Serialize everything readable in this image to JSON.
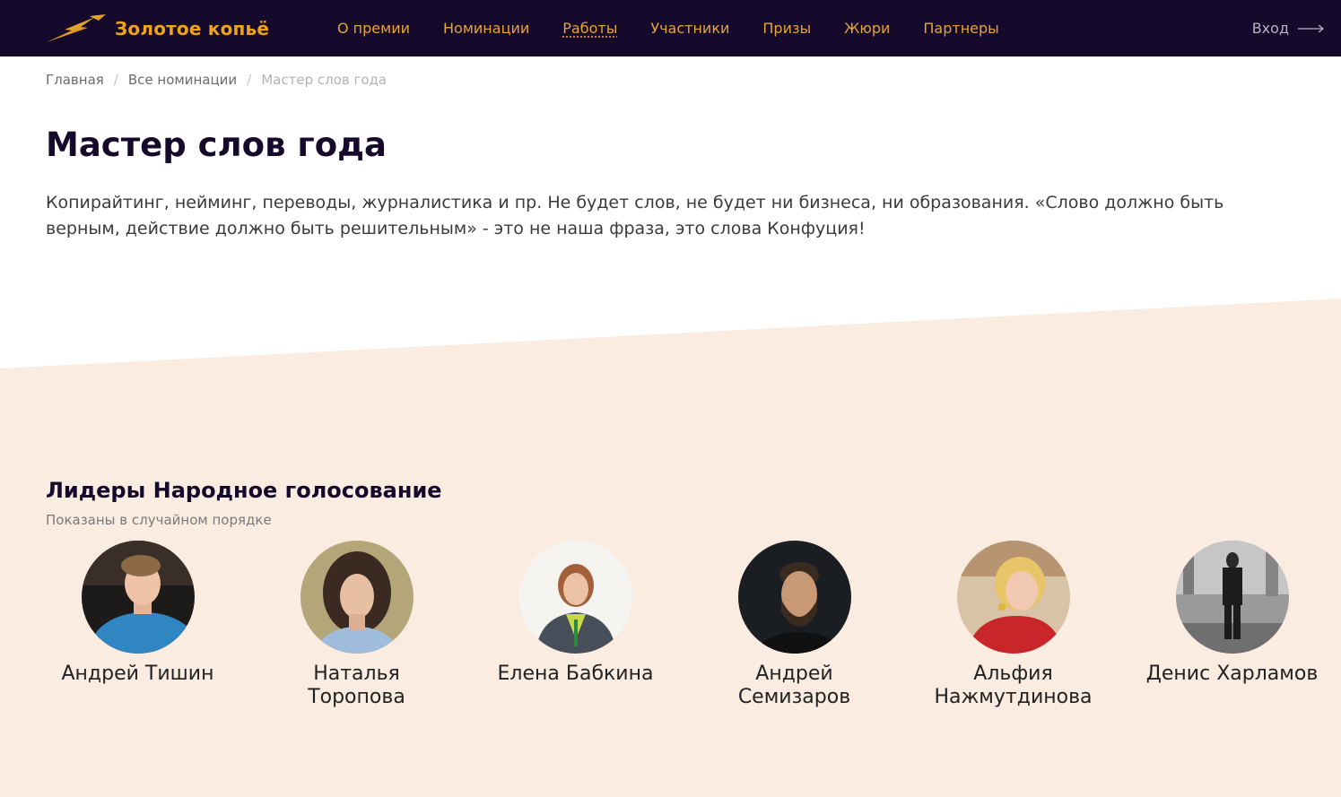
{
  "header": {
    "logo_text": "Золотое копьё",
    "nav": [
      {
        "label": "О премии",
        "active": false
      },
      {
        "label": "Номинации",
        "active": false
      },
      {
        "label": "Работы",
        "active": true
      },
      {
        "label": "Участники",
        "active": false
      },
      {
        "label": "Призы",
        "active": false
      },
      {
        "label": "Жюри",
        "active": false
      },
      {
        "label": "Партнеры",
        "active": false
      }
    ],
    "login_label": "Вход"
  },
  "breadcrumb": {
    "home": "Главная",
    "separator": "/",
    "nominations": "Все номинации",
    "current": "Мастер слов года"
  },
  "page": {
    "title": "Мастер слов года",
    "description": "Копирайтинг, нейминг, переводы, журналистика и пр. Не будет слов, не будет ни бизнеса, ни образования. «Слово должно быть верным, действие должно быть решительным» - это не наша фраза, это слова Конфуция!"
  },
  "leaders": {
    "title": "Лидеры Народное голосование",
    "subtitle": "Показаны в случайном порядке",
    "people": [
      {
        "name": "Андрей Тишин",
        "photo_tone": "#2f7fb5"
      },
      {
        "name": "Наталья Торопова",
        "photo_tone": "#8a7a5a"
      },
      {
        "name": "Елена Бабкина",
        "photo_tone": "#f4f1ec"
      },
      {
        "name": "Андрей Семизаров",
        "photo_tone": "#1e2226"
      },
      {
        "name": "Альфия Нажмутдинова",
        "photo_tone": "#c8262a"
      },
      {
        "name": "Денис Харламов",
        "photo_tone": "#8e8e8e"
      }
    ]
  },
  "colors": {
    "header_bg": "#150a2b",
    "accent_gold": "#f0a21a",
    "section_beige": "#faece0"
  }
}
